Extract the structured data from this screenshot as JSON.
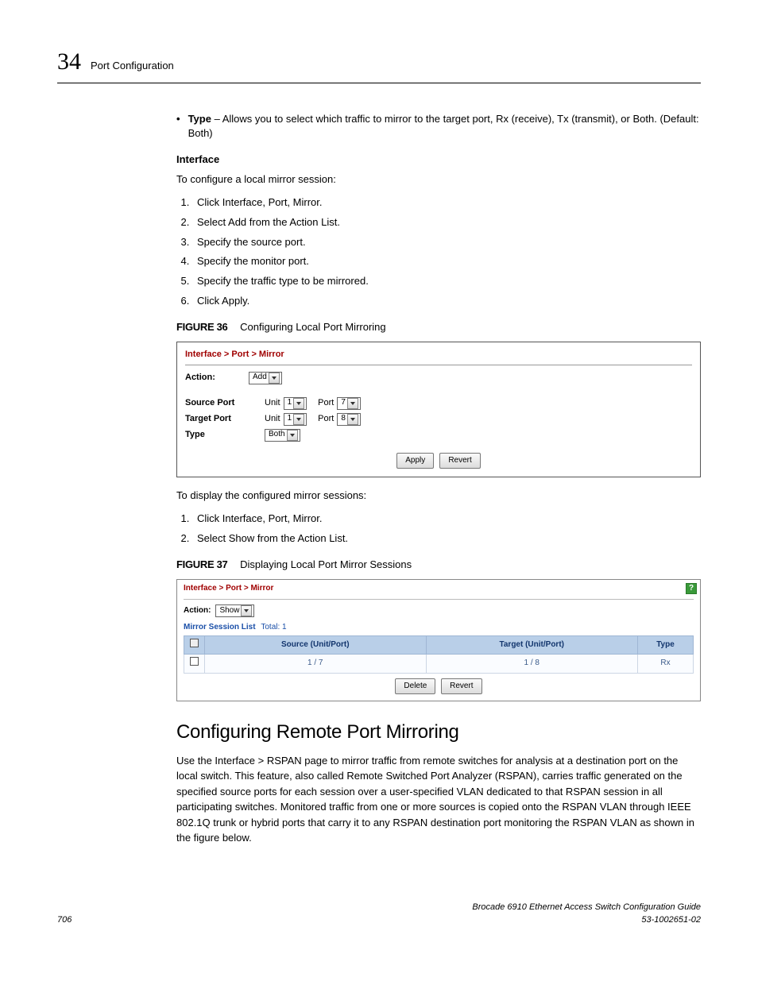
{
  "header": {
    "chapter_number": "34",
    "chapter_title": "Port Configuration"
  },
  "type_bullet": {
    "label": "Type",
    "text": " – Allows you to select which traffic to mirror to the target port, Rx (receive), Tx (transmit), or Both. (Default: Both)"
  },
  "interface_heading": "Interface",
  "interface_intro": "To configure a local mirror session:",
  "steps_configure": [
    "Click Interface, Port, Mirror.",
    "Select Add from the Action List.",
    "Specify the source port.",
    "Specify the monitor port.",
    "Specify the traffic type to be mirrored.",
    "Click Apply."
  ],
  "figure36": {
    "num": "FIGURE 36",
    "title": "Configuring Local Port Mirroring",
    "breadcrumb": "Interface > Port > Mirror",
    "action_label": "Action:",
    "action_value": "Add",
    "rows": {
      "source_label": "Source Port",
      "target_label": "Target Port",
      "type_label": "Type",
      "unit_label": "Unit",
      "port_label": "Port",
      "src_unit": "1",
      "src_port": "7",
      "tgt_unit": "1",
      "tgt_port": "8",
      "type_value": "Both"
    },
    "apply_btn": "Apply",
    "revert_btn": "Revert"
  },
  "display_intro": "To display the configured mirror sessions:",
  "steps_display": [
    "Click Interface, Port, Mirror.",
    "Select Show from the Action List."
  ],
  "figure37": {
    "num": "FIGURE 37",
    "title": "Displaying Local Port Mirror Sessions",
    "breadcrumb": "Interface > Port > Mirror",
    "action_label": "Action:",
    "action_value": "Show",
    "list_title": "Mirror Session List",
    "total_label": "Total: 1",
    "columns": {
      "c1": "Source (Unit/Port)",
      "c2": "Target (Unit/Port)",
      "c3": "Type"
    },
    "row": {
      "source": "1 / 7",
      "target": "1 / 8",
      "type": "Rx"
    },
    "delete_btn": "Delete",
    "revert_btn": "Revert",
    "help": "?"
  },
  "section_heading": "Configuring Remote Port Mirroring",
  "section_body": "Use the Interface > RSPAN page to mirror traffic from remote switches for analysis at a destination port on the local switch. This feature, also called Remote Switched Port Analyzer (RSPAN), carries traffic generated on the specified source ports for each session over a user-specified VLAN dedicated to that RSPAN session in all participating switches. Monitored traffic from one or more sources is copied onto the RSPAN VLAN through IEEE 802.1Q trunk or hybrid ports that carry it to any RSPAN destination port monitoring the RSPAN VLAN as shown in the figure below.",
  "footer": {
    "page": "706",
    "guide": "Brocade 6910 Ethernet Access Switch Configuration Guide",
    "docnum": "53-1002651-02"
  }
}
